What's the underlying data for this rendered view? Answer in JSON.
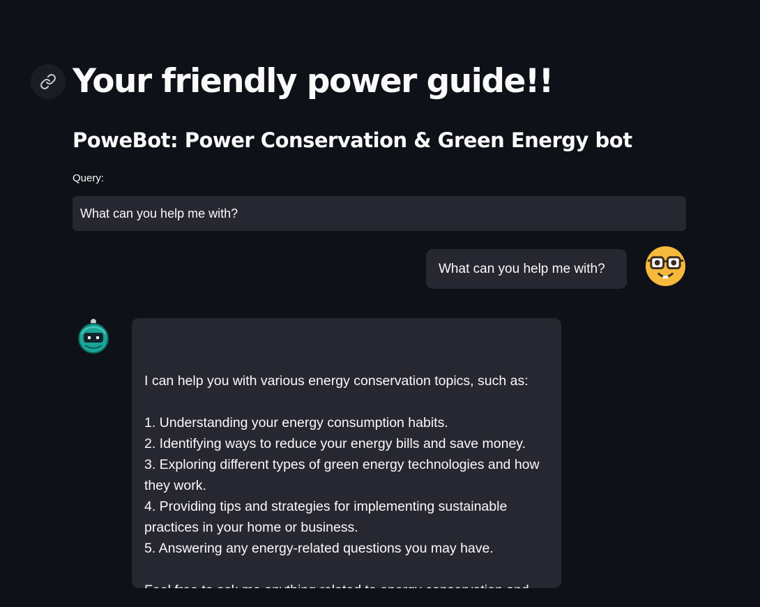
{
  "header": {
    "title": "Your friendly power guide!!",
    "subtitle": "PoweBot: Power Conservation & Green Energy bot",
    "anchor_icon": "link-icon"
  },
  "query": {
    "label": "Query:",
    "value": "What can you help me with?"
  },
  "chat": {
    "messages": [
      {
        "role": "user",
        "avatar_icon": "nerd-face-icon",
        "text": "What can you help me with?"
      },
      {
        "role": "bot",
        "avatar_icon": "robot-icon",
        "text": "I can help you with various energy conservation topics, such as:\n\n1. Understanding your energy consumption habits.\n2. Identifying ways to reduce your energy bills and save money.\n3. Exploring different types of green energy technologies and how they work.\n4. Providing tips and strategies for implementing sustainable practices in your home or business.\n5. Answering any energy-related questions you may have.\n\nFeel free to ask me anything related to energy conservation and green energy!"
      }
    ]
  },
  "colors": {
    "background": "#0e1117",
    "surface": "#262730",
    "text": "#fafafa",
    "user_avatar": "#f6b93b",
    "bot_avatar": "#1aa59a"
  }
}
